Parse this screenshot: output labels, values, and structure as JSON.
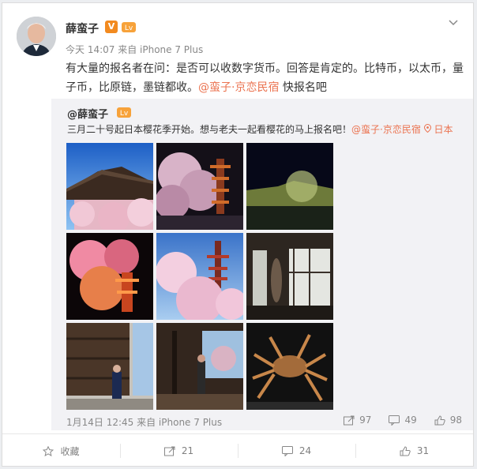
{
  "post": {
    "author": "薛蛮子",
    "meta": "今天 14:07 来自 iPhone 7 Plus",
    "text_main": "有大量的报名者在问：是否可以收数字货币。回答是肯定的。比特币，以太币，量子币，比原链，墨链都收。",
    "text_link": "@蛮子·京恋民宿",
    "text_tail": " 快报名吧"
  },
  "repost": {
    "author": "@薛蛮子",
    "text_main": "三月二十号起日本樱花季开始。想与老夫一起看樱花的马上报名吧！",
    "text_link": "@蛮子·京恋民宿",
    "location": "日本",
    "footer": "1月14日 12:45 来自 iPhone 7 Plus",
    "stats": {
      "reposts": "97",
      "comments": "49",
      "likes": "98"
    }
  },
  "actions": {
    "fav": "收藏",
    "repost": "21",
    "comment": "24",
    "like": "31"
  },
  "colors": {
    "accent": "#eb7350",
    "badge": "#f28a1f"
  },
  "icons": [
    "verified-v-icon",
    "level-badge-icon",
    "chevron-down-icon",
    "location-icon",
    "repost-icon",
    "comment-icon",
    "like-icon",
    "star-icon"
  ]
}
